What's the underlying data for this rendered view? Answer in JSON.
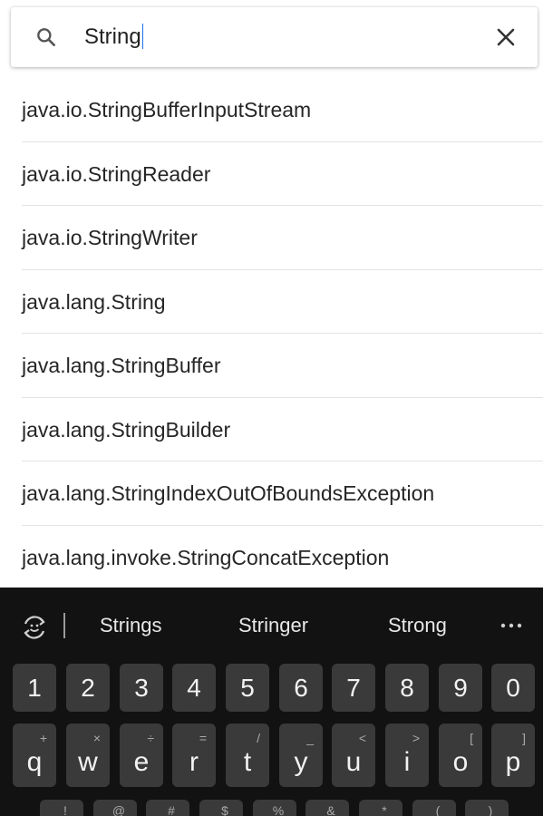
{
  "search": {
    "value": "String"
  },
  "results": [
    "java.io.StringBufferInputStream",
    "java.io.StringReader",
    "java.io.StringWriter",
    "java.lang.String",
    "java.lang.StringBuffer",
    "java.lang.StringBuilder",
    "java.lang.StringIndexOutOfBoundsException",
    "java.lang.invoke.StringConcatException"
  ],
  "keyboard": {
    "suggestions": [
      "Strings",
      "Stringer",
      "Strong"
    ],
    "number_row": [
      "1",
      "2",
      "3",
      "4",
      "5",
      "6",
      "7",
      "8",
      "9",
      "0"
    ],
    "letter_row": [
      {
        "key": "q",
        "alt": "+"
      },
      {
        "key": "w",
        "alt": "×"
      },
      {
        "key": "e",
        "alt": "÷"
      },
      {
        "key": "r",
        "alt": "="
      },
      {
        "key": "t",
        "alt": "/"
      },
      {
        "key": "y",
        "alt": "_"
      },
      {
        "key": "u",
        "alt": "<"
      },
      {
        "key": "i",
        "alt": ">"
      },
      {
        "key": "o",
        "alt": "["
      },
      {
        "key": "p",
        "alt": "]"
      }
    ],
    "symbol_row_partial": [
      "!",
      "@",
      "#",
      "$",
      "%",
      "&",
      "*",
      "(",
      ")"
    ]
  }
}
